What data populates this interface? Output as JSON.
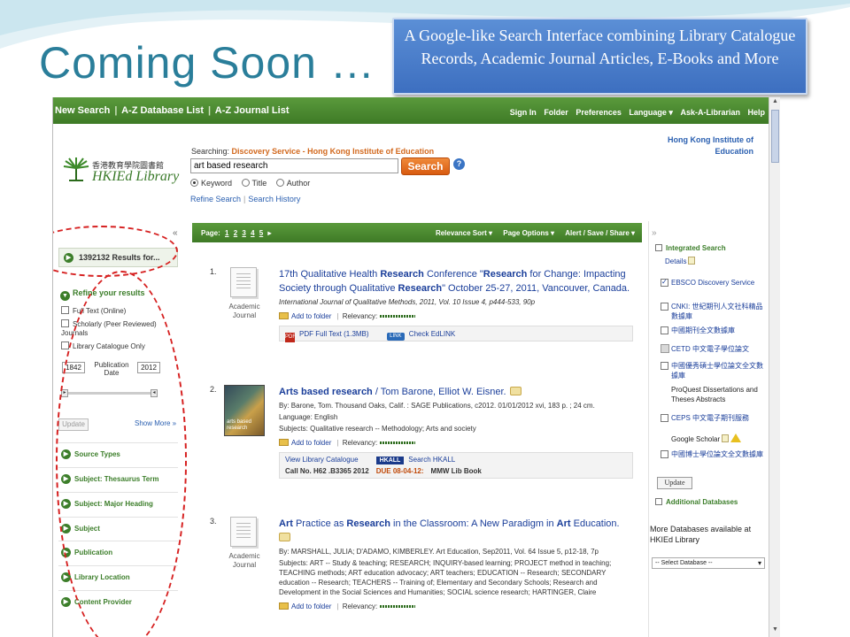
{
  "slide": {
    "title": "Coming Soon …",
    "callout": "A Google-like Search Interface combining Library Catalogue Records, Academic Journal Articles, E-Books and More"
  },
  "topnav": {
    "left": [
      "New Search",
      "A-Z Database List",
      "A-Z Journal List"
    ],
    "right": [
      "Sign In",
      "Folder",
      "Preferences",
      "Language ▾",
      "Ask-A-Librarian",
      "Help"
    ]
  },
  "header": {
    "logo_cn": "香港教育學院圖書館",
    "logo_en": "HKIEd Library",
    "searching_label": "Searching:",
    "searching_value": "Discovery Service - Hong Kong Institute of Education",
    "query": "art based research",
    "search_button": "Search",
    "help": "?",
    "radio_options": [
      "Keyword",
      "Title",
      "Author"
    ],
    "refine_search": "Refine Search",
    "search_history": "Search History",
    "institution": "Hong Kong Institute of Education"
  },
  "left": {
    "results": "1392132 Results for...",
    "refine_head": "Refine your results",
    "options": [
      "Full Text (Online)",
      "Scholarly (Peer Reviewed) Journals",
      "Library Catalogue Only"
    ],
    "pubdate_label": "Publication Date",
    "year_from": "1842",
    "year_to": "2012",
    "update": "Update",
    "show_more": "Show More »",
    "facets": [
      "Source Types",
      "Subject: Thesaurus Term",
      "Subject: Major Heading",
      "Subject",
      "Publication",
      "Library Location",
      "Content Provider"
    ]
  },
  "resbar": {
    "page_label": "Page:",
    "pages": [
      "1",
      "2",
      "3",
      "4",
      "5"
    ],
    "sort": "Relevance Sort ▾",
    "page_options": "Page Options ▾",
    "alert": "Alert / Save / Share ▾"
  },
  "results": [
    {
      "num": "1.",
      "type": "Academic Journal",
      "title_a": "17th Qualitative Health ",
      "title_b": "Research",
      "title_c": " Conference \"",
      "title_d": "Research",
      "title_e": " for Change: Impacting Society through Qualitative ",
      "title_f": "Research",
      "title_g": "\" October 25-27, 2011, Vancouver, Canada.",
      "meta": "International Journal of Qualitative Methods, 2011, Vol. 10 Issue 4, p444-533, 90p",
      "add_folder": "Add to folder",
      "relevancy": "Relevancy:",
      "pdf": "PDF Full Text",
      "pdf_size": "(1.3MB)",
      "check": "Check EdLINK"
    },
    {
      "num": "2.",
      "cover_text": "arts based research",
      "title_a": "Arts based research",
      "title_b": " / Tom Barone, Elliot W. Eisner.",
      "by": "By: Barone, Tom. Thousand Oaks, Calif. : SAGE Publications, c2012. 01/01/2012 xvi, 183 p. ; 24 cm.",
      "lang": "Language: English",
      "subjects": "Subjects: Qualitative research -- Methodology; Arts and society",
      "add_folder": "Add to folder",
      "relevancy": "Relevancy:",
      "view_cat": "View Library Catalogue",
      "hkall": "HKALL",
      "search_hkall": "Search HKALL",
      "callno": "Call No. H62 .B3365 2012",
      "due": "DUE 08-04-12:",
      "lib": "MMW Lib Book"
    },
    {
      "num": "3.",
      "type": "Academic Journal",
      "title_a": "Art",
      "title_b": " Practice as ",
      "title_c": "Research",
      "title_d": " in the Classroom: A New Paradigm in ",
      "title_e": "Art",
      "title_f": " Education.",
      "by": "By: MARSHALL, JULIA; D'ADAMO, KIMBERLEY. Art Education, Sep2011, Vol. 64 Issue 5, p12-18, 7p",
      "subjects": "Subjects: ART -- Study & teaching; RESEARCH; INQUIRY-based learning; PROJECT method in teaching; TEACHING methods; ART education advocacy; ART teachers; EDUCATION -- Research; SECONDARY education -- Research; TEACHERS -- Training of; Elementary and Secondary Schools; Research and Development in the Social Sciences and Humanities; SOCIAL science research; HARTINGER, Claire",
      "add_folder": "Add to folder",
      "relevancy": "Relevancy:"
    }
  ],
  "right": {
    "integrated": "Integrated Search",
    "details": "Details",
    "databases": [
      {
        "label": "EBSCO Discovery Service",
        "checked": true
      },
      {
        "label": "CNKI: 世紀期刊人文社科精品數據庫",
        "checked": false
      },
      {
        "label": "中國期刊全文數據庫",
        "checked": false
      },
      {
        "label": "CETD 中文電子學位論文",
        "checked": false
      },
      {
        "label": "中國優秀碩士學位論文全文數據庫",
        "checked": false
      },
      {
        "label": "ProQuest Dissertations and Theses Abstracts",
        "checked": false
      },
      {
        "label": "CEPS 中文電子期刊服務",
        "checked": false
      },
      {
        "label": "Google Scholar",
        "checked": false
      },
      {
        "label": "中國博士學位論文全文數據庫",
        "checked": false
      }
    ],
    "update": "Update",
    "additional": "Additional Databases",
    "more_db": "More Databases available at HKIEd Library",
    "select_db": "-- Select Database --"
  }
}
